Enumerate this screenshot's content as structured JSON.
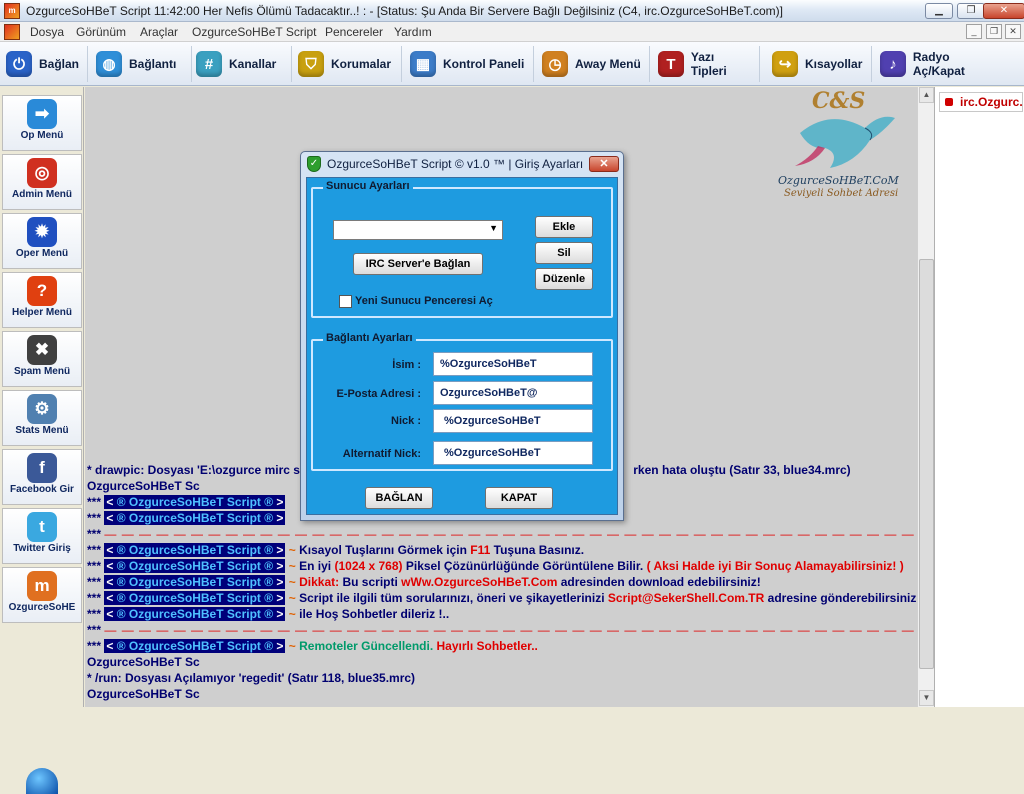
{
  "window": {
    "title": "OzgurceSoHBeT Script 11:42:00 Her Nefis Ölümü Tadacaktır..! : - [Status: Şu Anda Bir Servere Bağlı Değilsiniz (C4, irc.OzgurceSoHBeT.com)]"
  },
  "menu": [
    "Dosya",
    "Görünüm",
    "Araçlar",
    "OzgurceSoHBeT Script",
    "Pencereler",
    "Yardım"
  ],
  "toolbar": [
    {
      "label": "Bağlan",
      "icon": "plug-icon",
      "color": "#2a63c8"
    },
    {
      "label": "Bağlantı",
      "icon": "globe-icon",
      "color": "#2f8fd8"
    },
    {
      "label": "Kanallar",
      "icon": "hash-icon",
      "color": "#3aa0c0"
    },
    {
      "label": "Korumalar",
      "icon": "shield-icon",
      "color": "#c8a010"
    },
    {
      "label": "Kontrol Paneli",
      "icon": "control-panel-icon",
      "color": "#3c7cc8"
    },
    {
      "label": "Away Menü",
      "icon": "clock-icon",
      "color": "#d08020"
    },
    {
      "label": "Yazı Tipleri",
      "icon": "font-icon",
      "color": "#b02020"
    },
    {
      "label": "Kısayollar",
      "icon": "shortcut-icon",
      "color": "#d0a010"
    },
    {
      "label": "Radyo Aç/Kapat",
      "icon": "radio-icon",
      "color": "#5040b0"
    }
  ],
  "sidebar": [
    {
      "label": "Op Menü",
      "icon": "arrow-right-icon",
      "color": "#2a8ad8"
    },
    {
      "label": "Admin Menü",
      "icon": "lifebuoy-icon",
      "color": "#d03020"
    },
    {
      "label": "Oper Menü",
      "icon": "gear-blue-icon",
      "color": "#2050c0"
    },
    {
      "label": "Helper Menü",
      "icon": "help-icon",
      "color": "#e04010"
    },
    {
      "label": "Spam Menü",
      "icon": "tools-icon",
      "color": "#404040"
    },
    {
      "label": "Stats Menü",
      "icon": "gear-icon",
      "color": "#5080b0"
    },
    {
      "label": "Facebook Gir",
      "icon": "facebook-icon",
      "color": "#3b5998"
    },
    {
      "label": "Twitter Giriş",
      "icon": "twitter-icon",
      "color": "#3aa8e0"
    },
    {
      "label": "OzgurceSoHE",
      "icon": "app-icon",
      "color": "#e07020"
    }
  ],
  "logo": {
    "initials": "C&S",
    "name": "OzgurceSoHBeT.CoM",
    "tagline": "Seviyeli Sohbet Adresi"
  },
  "nicklist": {
    "item": "irc.Ozgurc..."
  },
  "tag": {
    "prefix": "< ",
    "name": "® OzgurceSoHBeT Script ®",
    "suffix": " >"
  },
  "chat": {
    "l1a": "* drawpic: Dosyası 'E:\\ozgurce mirc si",
    "l1b": "rken hata oluştu (Satır 33, blue34.mrc)",
    "l2": "OzgurceSoHBeT Sc",
    "stars": "***",
    "l5_text": "Kısayol Tuşlarını Görmek için ",
    "l5_key": "F11",
    "l5_end": " Tuşuna Basınız.",
    "l6_a": "En iyi ",
    "l6_res": "(1024 x 768)",
    "l6_b": " Piksel Çözünürlüğünde Görüntülene Bilir. ",
    "l6_c": "( Aksi Halde iyi Bir Sonuç Alamayabilirsiniz! )",
    "l7_a": "Dikkat:",
    "l7_b": " Bu scripti  ",
    "l7_url": "wWw.OzgurceSoHBeT.Com",
    "l7_c": " adresinden download edebilirsiniz!",
    "l8_a": "Script ile ilgili tüm sorularınızı, öneri ve şikayetlerinizi ",
    "l8_mail": "Script@SekerShell.Com.TR",
    "l8_b": " adresine gönderebilirsiniz.",
    "l9": "ile Hoş Sohbetler dileriz !..",
    "l11_a": " Remoteler Güncellendi.",
    "l11_b": " Hayırlı Sohbetler..",
    "l12": "OzgurceSoHBeT Sc",
    "l13": "* /run: Dosyası Açılamıyor 'regedit' (Satır 118, blue35.mrc)",
    "l14": "OzgurceSoHBeT Sc"
  },
  "dialog": {
    "title": "OzgurceSoHBeT Script © v1.0 ™ | Giriş Ayarları",
    "server_group": "Sunucu Ayarları",
    "add": "Ekle",
    "delete": "Sil",
    "edit": "Düzenle",
    "connect_server": "IRC Server'e Bağlan",
    "new_window": "Yeni Sunucu Penceresi Aç",
    "conn_group": "Bağlantı Ayarları",
    "name_label": "İsim :",
    "name_value": "%OzgurceSoHBeT",
    "email_label": "E-Posta Adresi :",
    "email_value": "OzgurceSoHBeT@",
    "nick_label": "Nick :",
    "nick_value": "%OzgurceSoHBeT",
    "alt_label": "Alternatif Nick:",
    "alt_value": "%OzgurceSoHBeT",
    "connect": "BAĞLAN",
    "close": "KAPAT"
  }
}
